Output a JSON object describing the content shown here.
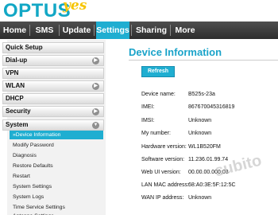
{
  "brand": {
    "logo_text": "OPTUS",
    "logo_accent": "yes",
    "primary_color": "#12a7c5",
    "accent_color": "#f6c400"
  },
  "topnav": {
    "tabs": [
      {
        "label": "Home"
      },
      {
        "label": "SMS"
      },
      {
        "label": "Update"
      },
      {
        "label": "Settings",
        "active": true
      },
      {
        "label": "Sharing"
      },
      {
        "label": "More"
      }
    ]
  },
  "sidebar": {
    "items": [
      {
        "label": "Quick Setup"
      },
      {
        "label": "Dial-up",
        "icon": "chevron-right-icon"
      },
      {
        "label": "VPN"
      },
      {
        "label": "WLAN",
        "icon": "chevron-right-icon"
      },
      {
        "label": "DHCP"
      },
      {
        "label": "Security",
        "icon": "chevron-right-icon"
      },
      {
        "label": "System",
        "icon": "chevron-down-icon"
      }
    ],
    "sub_items": [
      {
        "label": "Device Information",
        "active": true,
        "icon": "chevron-right-small-icon"
      },
      {
        "label": "Modify Password"
      },
      {
        "label": "Diagnosis"
      },
      {
        "label": "Restore Defaults"
      },
      {
        "label": "Restart"
      },
      {
        "label": "System Settings"
      },
      {
        "label": "System Logs"
      },
      {
        "label": "Time Service Settings"
      },
      {
        "label": "Antenna Settings"
      }
    ]
  },
  "main": {
    "title": "Device Information",
    "refresh_label": "Refresh",
    "fields": [
      {
        "label": "Device name:",
        "value": "B525s-23a"
      },
      {
        "label": "IMEI:",
        "value": "867670045316819"
      },
      {
        "label": "IMSI:",
        "value": "Unknown"
      },
      {
        "label": "My number:",
        "value": "Unknown"
      },
      {
        "label": "Hardware version:",
        "value": "WL1B520FM"
      },
      {
        "label": "Software version:",
        "value": "11.236.01.99.74"
      },
      {
        "label": "Web UI version:",
        "value": "00.00.00.000.03"
      },
      {
        "label": "LAN MAC address:",
        "value": "68:A0:3E:5F:12:5C"
      },
      {
        "label": "WAN IP address:",
        "value": "Unknown"
      }
    ]
  },
  "watermark": "subito"
}
